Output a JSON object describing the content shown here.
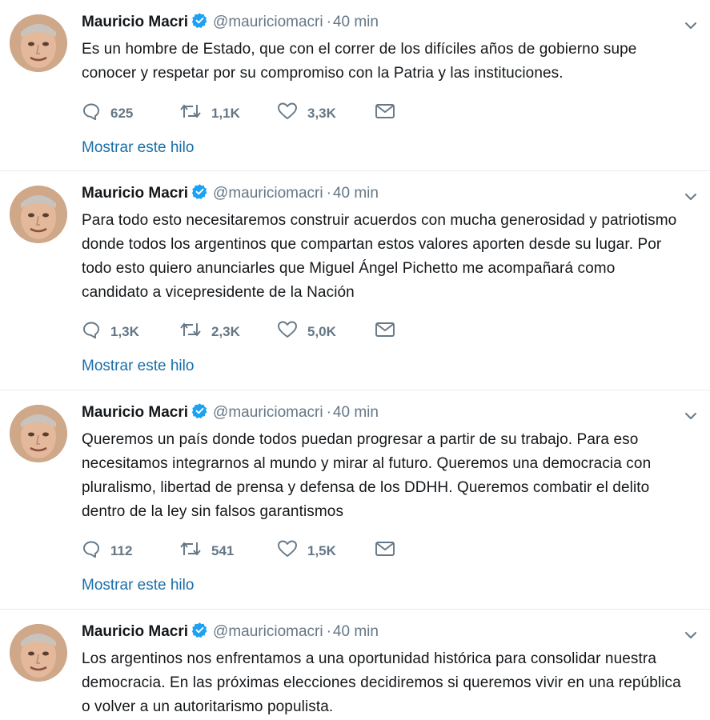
{
  "tweets": [
    {
      "name": "Mauricio Macri",
      "handle": "@mauriciomacri",
      "separator": "·",
      "time": "40 min",
      "text": "Es un hombre de Estado, que con el correr de los difíciles años de gobierno supe conocer y respetar por su compromiso con la Patria y las instituciones.",
      "replies": "625",
      "retweets": "1,1K",
      "likes": "3,3K",
      "thread_link": "Mostrar este hilo"
    },
    {
      "name": "Mauricio Macri",
      "handle": "@mauriciomacri",
      "separator": "·",
      "time": "40 min",
      "text": "Para todo esto necesitaremos construir acuerdos con mucha generosidad y patriotismo donde todos los argentinos que compartan estos valores aporten desde su lugar. Por todo esto quiero anunciarles que Miguel Ángel Pichetto me acompañará como candidato a vicepresidente de la Nación",
      "replies": "1,3K",
      "retweets": "2,3K",
      "likes": "5,0K",
      "thread_link": "Mostrar este hilo"
    },
    {
      "name": "Mauricio Macri",
      "handle": "@mauriciomacri",
      "separator": "·",
      "time": "40 min",
      "text": "Queremos un país donde todos puedan progresar a partir de su trabajo. Para eso necesitamos integrarnos al mundo y mirar al futuro. Queremos una democracia con pluralismo, libertad de prensa y defensa de los DDHH. Queremos combatir el delito dentro de la ley sin falsos garantismos",
      "replies": "112",
      "retweets": "541",
      "likes": "1,5K",
      "thread_link": "Mostrar este hilo"
    },
    {
      "name": "Mauricio Macri",
      "handle": "@mauriciomacri",
      "separator": "·",
      "time": "40 min",
      "text": "Los argentinos nos enfrentamos a una oportunidad histórica para consolidar nuestra democracia. En las próximas elecciones decidiremos si queremos vivir en una república o volver a un autoritarismo populista."
    }
  ],
  "icons": {
    "reply": "reply-icon",
    "retweet": "retweet-icon",
    "like": "heart-icon",
    "dm": "envelope-icon",
    "verified": "verified-badge-icon",
    "caret": "chevron-down-icon"
  },
  "colors": {
    "link": "#1b6fa8",
    "verified": "#1da1f2",
    "muted": "#657786",
    "text": "#14171a"
  }
}
